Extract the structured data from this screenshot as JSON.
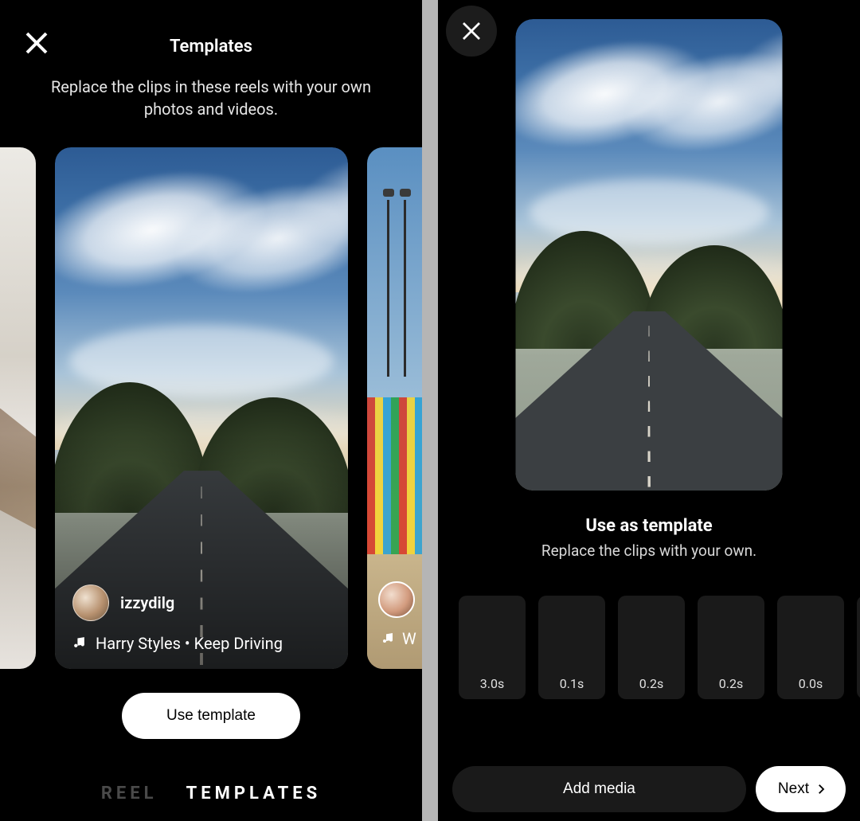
{
  "left": {
    "title": "Templates",
    "subtitle": "Replace the clips in these reels with your own photos and videos.",
    "card": {
      "username": "izzydilg",
      "music": "Harry Styles • Keep Driving"
    },
    "peek_right": {
      "music_partial": "W"
    },
    "use_template_button": "Use template",
    "tabs": {
      "reel": "REEL",
      "templates": "TEMPLATES"
    }
  },
  "right": {
    "title": "Use as template",
    "subtitle": "Replace the clips with your own.",
    "slots": [
      "3.0s",
      "0.1s",
      "0.2s",
      "0.2s",
      "0.0s"
    ],
    "add_media_button": "Add media",
    "next_button": "Next"
  }
}
